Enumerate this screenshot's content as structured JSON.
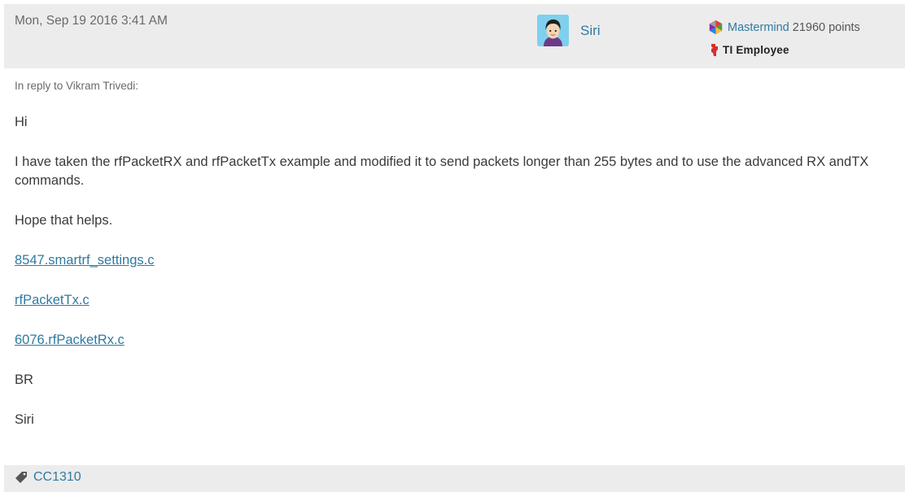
{
  "post": {
    "timestamp": "Mon, Sep 19 2016 3:41 AM",
    "author": {
      "name": "Siri",
      "avatar_icon": "user-avatar-icon"
    },
    "rank": {
      "name": "Mastermind",
      "points": "21960 points",
      "icon": "mastermind-rank-icon"
    },
    "badge": {
      "label": "TI Employee",
      "icon": "ti-logo-icon"
    },
    "reply_to": "In reply to Vikram Trivedi:",
    "paragraphs": [
      "Hi",
      "I have taken the rfPacketRX and rfPacketTx example and modified it to send packets longer than 255 bytes and to use the advanced RX andTX commands.",
      "Hope that helps."
    ],
    "attachments": [
      "8547.smartrf_settings.c",
      "rfPacketTx.c",
      "6076.rfPacketRx.c"
    ],
    "closing": [
      "BR",
      "Siri"
    ],
    "tag": {
      "label": "CC1310",
      "icon": "tag-icon"
    }
  },
  "colors": {
    "header_bg": "#ececec",
    "link": "#2f7aa0",
    "text": "#3a3a3a",
    "muted": "#6a6a6a"
  }
}
